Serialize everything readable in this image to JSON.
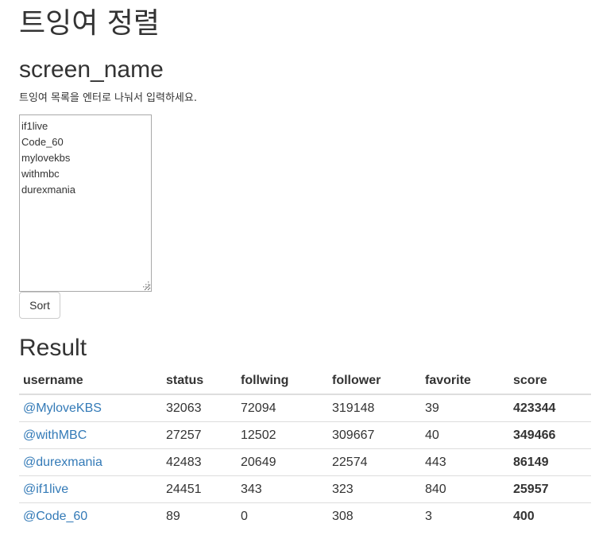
{
  "page": {
    "title": "트잉여 정렬"
  },
  "input_section": {
    "heading": "screen_name",
    "instructions": "트잉여 목록을 엔터로 나눠서 입력하세요.",
    "textarea_value": "if1live\nCode_60\nmylovekbs\nwithmbc\ndurexmania",
    "sort_button_label": "Sort"
  },
  "result_section": {
    "heading": "Result",
    "columns": [
      "username",
      "status",
      "follwing",
      "follower",
      "favorite",
      "score"
    ],
    "rows": [
      {
        "username": "@MyloveKBS",
        "status": "32063",
        "follwing": "72094",
        "follower": "319148",
        "favorite": "39",
        "score": "423344"
      },
      {
        "username": "@withMBC",
        "status": "27257",
        "follwing": "12502",
        "follower": "309667",
        "favorite": "40",
        "score": "349466"
      },
      {
        "username": "@durexmania",
        "status": "42483",
        "follwing": "20649",
        "follower": "22574",
        "favorite": "443",
        "score": "86149"
      },
      {
        "username": "@if1live",
        "status": "24451",
        "follwing": "343",
        "follower": "323",
        "favorite": "840",
        "score": "25957"
      },
      {
        "username": "@Code_60",
        "status": "89",
        "follwing": "0",
        "follower": "308",
        "favorite": "3",
        "score": "400"
      }
    ]
  },
  "colors": {
    "link": "#337ab7",
    "text": "#333333",
    "border": "#dddddd"
  }
}
